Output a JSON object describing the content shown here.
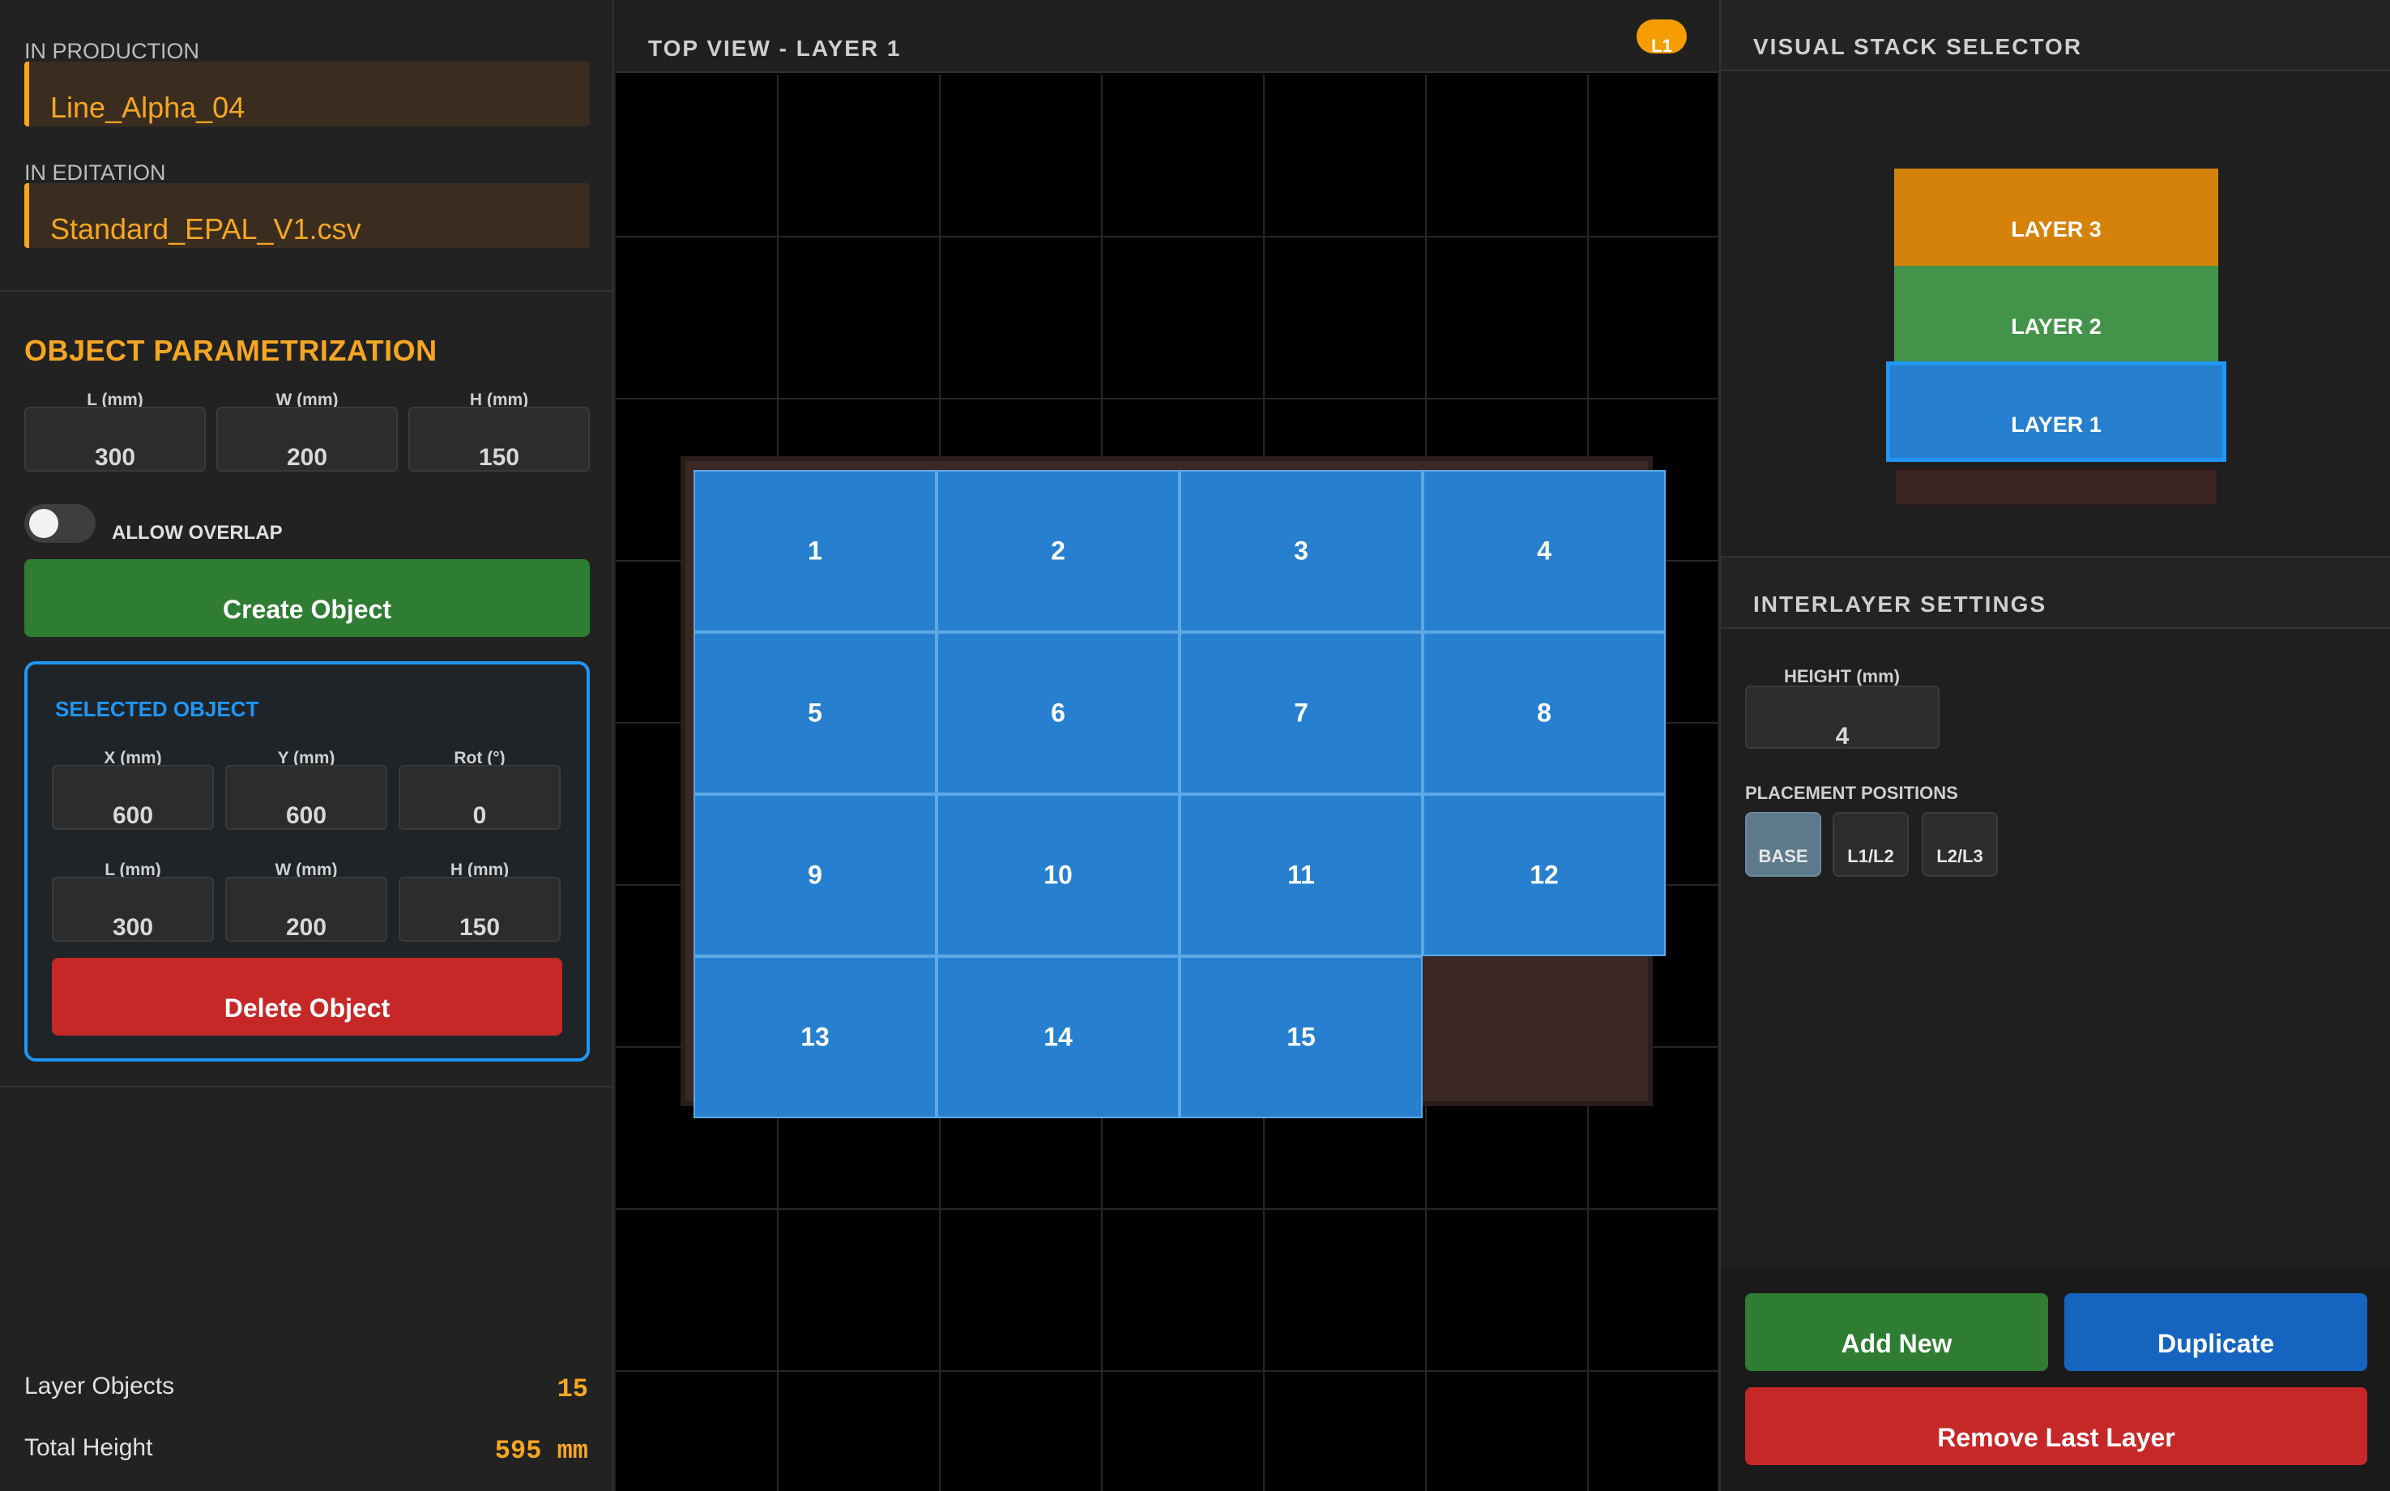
{
  "production": {
    "label": "IN PRODUCTION",
    "value": "Line_Alpha_04"
  },
  "edition": {
    "label": "IN EDITATION",
    "value": "Standard_EPAL_V1.csv"
  },
  "parametrization": {
    "title": "OBJECT PARAMETRIZATION",
    "fields": [
      {
        "label": "L (mm)",
        "value": "300"
      },
      {
        "label": "W (mm)",
        "value": "200"
      },
      {
        "label": "H (mm)",
        "value": "150"
      }
    ],
    "overlap_label": "ALLOW OVERLAP",
    "overlap_on": false,
    "create_label": "Create Object"
  },
  "selected": {
    "title": "SELECTED OBJECT",
    "position": [
      {
        "label": "X (mm)",
        "value": "600"
      },
      {
        "label": "Y (mm)",
        "value": "600"
      },
      {
        "label": "Rot (°)",
        "value": "0"
      }
    ],
    "dims": [
      {
        "label": "L (mm)",
        "value": "300"
      },
      {
        "label": "W (mm)",
        "value": "200"
      },
      {
        "label": "H (mm)",
        "value": "150"
      }
    ],
    "delete_label": "Delete Object"
  },
  "stats": {
    "layer_objects_label": "Layer Objects",
    "layer_objects_value": "15",
    "total_height_label": "Total Height",
    "total_height_value": "595 mm"
  },
  "top_view": {
    "title": "TOP VIEW - LAYER 1",
    "badge": "L1",
    "tiles": [
      "1",
      "2",
      "3",
      "4",
      "5",
      "6",
      "7",
      "8",
      "9",
      "10",
      "11",
      "12",
      "13",
      "14",
      "15"
    ]
  },
  "stack_selector": {
    "title": "VISUAL STACK SELECTOR",
    "layers": [
      {
        "label": "LAYER 3",
        "color": "#d4820a"
      },
      {
        "label": "LAYER 2",
        "color": "#43944a"
      },
      {
        "label": "LAYER 1",
        "color": "#2680cf",
        "selected": true
      }
    ]
  },
  "interlayer": {
    "title": "INTERLAYER SETTINGS",
    "height_label": "HEIGHT (mm)",
    "height_value": "4",
    "positions_label": "PLACEMENT POSITIONS",
    "positions": [
      "BASE",
      "L1/L2",
      "L2/L3"
    ],
    "active_position": "BASE"
  },
  "actions": {
    "add_new": "Add New",
    "duplicate": "Duplicate",
    "remove_last": "Remove Last Layer"
  },
  "colors": {
    "accent": "#f5a623",
    "selected_blue": "#2196f3",
    "tile_blue": "#2680cf",
    "green": "#2e7d32",
    "red": "#c62828"
  }
}
